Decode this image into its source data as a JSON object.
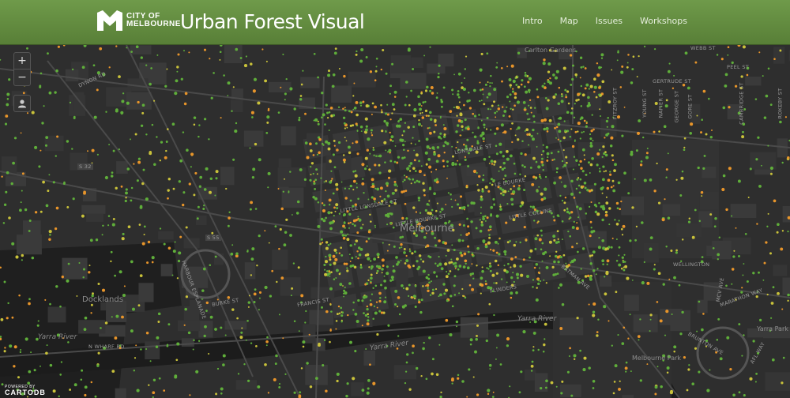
{
  "header": {
    "logo_line1": "CITY OF",
    "logo_line2": "MELBOURNE",
    "title": "Urban Forest Visual",
    "nav": [
      {
        "label": "Intro"
      },
      {
        "label": "Map"
      },
      {
        "label": "Issues"
      },
      {
        "label": "Workshops"
      }
    ]
  },
  "map_controls": {
    "zoom_in": "+",
    "zoom_out": "−"
  },
  "map_labels": {
    "city": "Melbourne",
    "docklands": "Docklands",
    "yarra_river_1": "Yarra River",
    "yarra_river_2": "Yarra River",
    "yarra_river_3": "Yarra River",
    "yarra_park": "Yarra Park",
    "melbourne_park": "Melbourne Park",
    "carlton_gardens": "Carlton Gardens",
    "streets": {
      "dynon": "DYNON RD",
      "n_wharf": "N WHARF RD",
      "harbour": "HARBOUR ESPLANADE",
      "gertrude": "GERTRUDE ST",
      "webb": "WEBB ST",
      "peel": "PEEL ST",
      "little_lonsdale": "LITTLE LONSDALE ST",
      "lonsdale": "LONSDALE ST",
      "little_bourke": "LITTLE BOURKE ST",
      "le_bourke": "LE BOURKE",
      "little_collins": "LITTLE COLLINS",
      "flinders": "FLINDERS",
      "francis": "FRANCIS ST",
      "burke": "BURKE ST",
      "batman": "BATMAN AVE",
      "wellington": "WELLINGTON",
      "mcv": "MCV AVE",
      "marathon": "MARATHON WAY",
      "brunton": "BRUNTON AVE",
      "afl": "AFL WAY",
      "fitzroy": "FITZROY ST",
      "napier": "NAPIER ST",
      "george": "GEORGE ST",
      "gore": "GORE ST",
      "young": "YOUNG ST",
      "cambridge": "CAMBRIDGE ST",
      "rokeby": "ROKEBY ST",
      "s55": "S 55",
      "s32": "S 32"
    }
  },
  "attribution": {
    "powered_by": "POWERED BY",
    "brand": "CARTODB"
  },
  "colors": {
    "header_green": "#628c40",
    "tree_green": "#5fae3a",
    "tree_orange": "#e8952a",
    "tree_yellow": "#c9c23a"
  }
}
